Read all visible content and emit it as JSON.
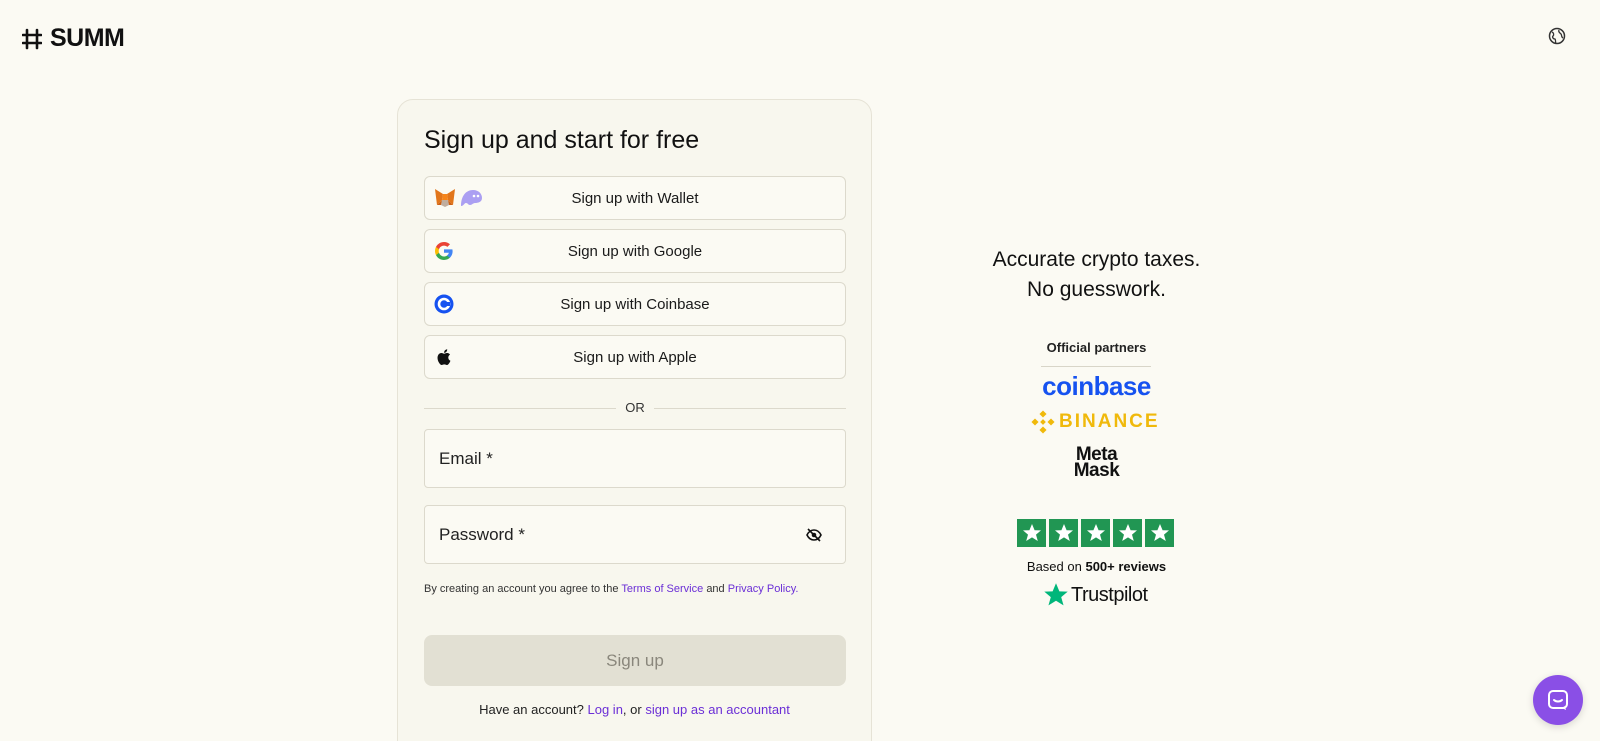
{
  "brand": {
    "name": "SUMM"
  },
  "card": {
    "title": "Sign up and start for free",
    "social_buttons": [
      {
        "label": "Sign up with Wallet",
        "icon": "metamask-and-phantom-icons"
      },
      {
        "label": "Sign up with Google",
        "icon": "google-icon"
      },
      {
        "label": "Sign up with Coinbase",
        "icon": "coinbase-icon"
      },
      {
        "label": "Sign up with Apple",
        "icon": "apple-icon"
      }
    ],
    "divider_text": "OR",
    "email": {
      "label": "Email *",
      "value": ""
    },
    "password": {
      "label": "Password *",
      "value": ""
    },
    "terms": {
      "prefix": "By creating an account you agree to the",
      "tos_link": "Terms of Service",
      "and": "and",
      "privacy_link": "Privacy Policy",
      "suffix": "."
    },
    "signup_button": "Sign up",
    "bottom": {
      "prefix": "Have an account?",
      "login_link": "Log in",
      "middle": ", or",
      "accountant_link": "sign up as an accountant"
    }
  },
  "side": {
    "tagline_line1": "Accurate crypto taxes.",
    "tagline_line2": "No guesswork.",
    "partners_title": "Official partners",
    "partners": {
      "coinbase": "coinbase",
      "binance": "BINANCE",
      "metamask_line1": "Meta",
      "metamask_line2": "Mask"
    },
    "rating_stars": 5,
    "reviews_prefix": "Based on",
    "reviews_count": "500+ reviews",
    "trustpilot": "Trustpilot"
  },
  "colors": {
    "background": "#fbfaf3",
    "link": "#6b2fd6",
    "coinbase_blue": "#1652f0",
    "binance_yellow": "#f0b90b",
    "trustpilot_green": "#219653",
    "chat_purple": "#8a4fe6"
  }
}
